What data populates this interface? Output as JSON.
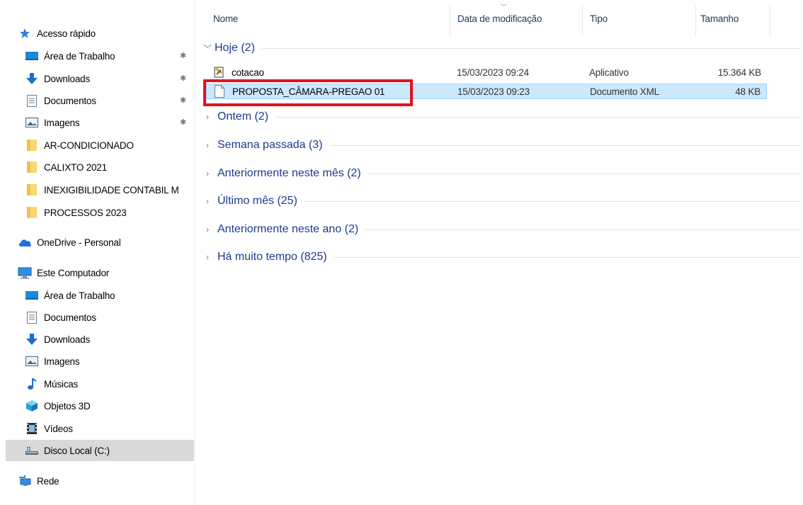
{
  "sidebar": {
    "quick_access": "Acesso rápido",
    "quick_items": [
      {
        "label": "Área de Trabalho",
        "icon": "desktop-icon"
      },
      {
        "label": "Downloads",
        "icon": "download-arrow-icon"
      },
      {
        "label": "Documentos",
        "icon": "document-icon"
      },
      {
        "label": "Imagens",
        "icon": "pictures-icon"
      },
      {
        "label": "AR-CONDICIONADO",
        "icon": "folder-icon"
      },
      {
        "label": "CALIXTO 2021",
        "icon": "folder-icon"
      },
      {
        "label": "INEXIGIBILIDADE CONTABIL M",
        "icon": "folder-icon"
      },
      {
        "label": "PROCESSOS 2023",
        "icon": "folder-icon"
      }
    ],
    "onedrive": "OneDrive - Personal",
    "this_pc": "Este Computador",
    "pc_items": [
      {
        "label": "Área de Trabalho",
        "icon": "desktop-icon"
      },
      {
        "label": "Documentos",
        "icon": "document-icon"
      },
      {
        "label": "Downloads",
        "icon": "download-arrow-icon"
      },
      {
        "label": "Imagens",
        "icon": "pictures-icon"
      },
      {
        "label": "Músicas",
        "icon": "music-note-icon"
      },
      {
        "label": "Objetos 3D",
        "icon": "cube-3d-icon"
      },
      {
        "label": "Vídeos",
        "icon": "film-icon"
      },
      {
        "label": "Disco Local (C:)",
        "icon": "drive-icon"
      }
    ],
    "network": "Rede"
  },
  "columns": {
    "name": "Nome",
    "date": "Data de modificação",
    "type": "Tipo",
    "size": "Tamanho"
  },
  "groups": {
    "today": "Hoje (2)",
    "yesterday": "Ontem (2)",
    "last_week": "Semana passada (3)",
    "earlier_month": "Anteriormente neste mês (2)",
    "last_month": "Último mês (25)",
    "earlier_year": "Anteriormente neste ano (2)",
    "long_ago": "Há muito tempo (825)"
  },
  "files": [
    {
      "name": "cotacao",
      "date": "15/03/2023 09:24",
      "type": "Aplicativo",
      "size": "15.364 KB"
    },
    {
      "name": "PROPOSTA_CÂMARA-PREGAO 01",
      "date": "15/03/2023 09:23",
      "type": "Documento XML",
      "size": "48 KB"
    }
  ],
  "colors": {
    "selection": "#cce8ff",
    "highlight_box": "#e0121d",
    "group_text": "#1b3b8f"
  }
}
